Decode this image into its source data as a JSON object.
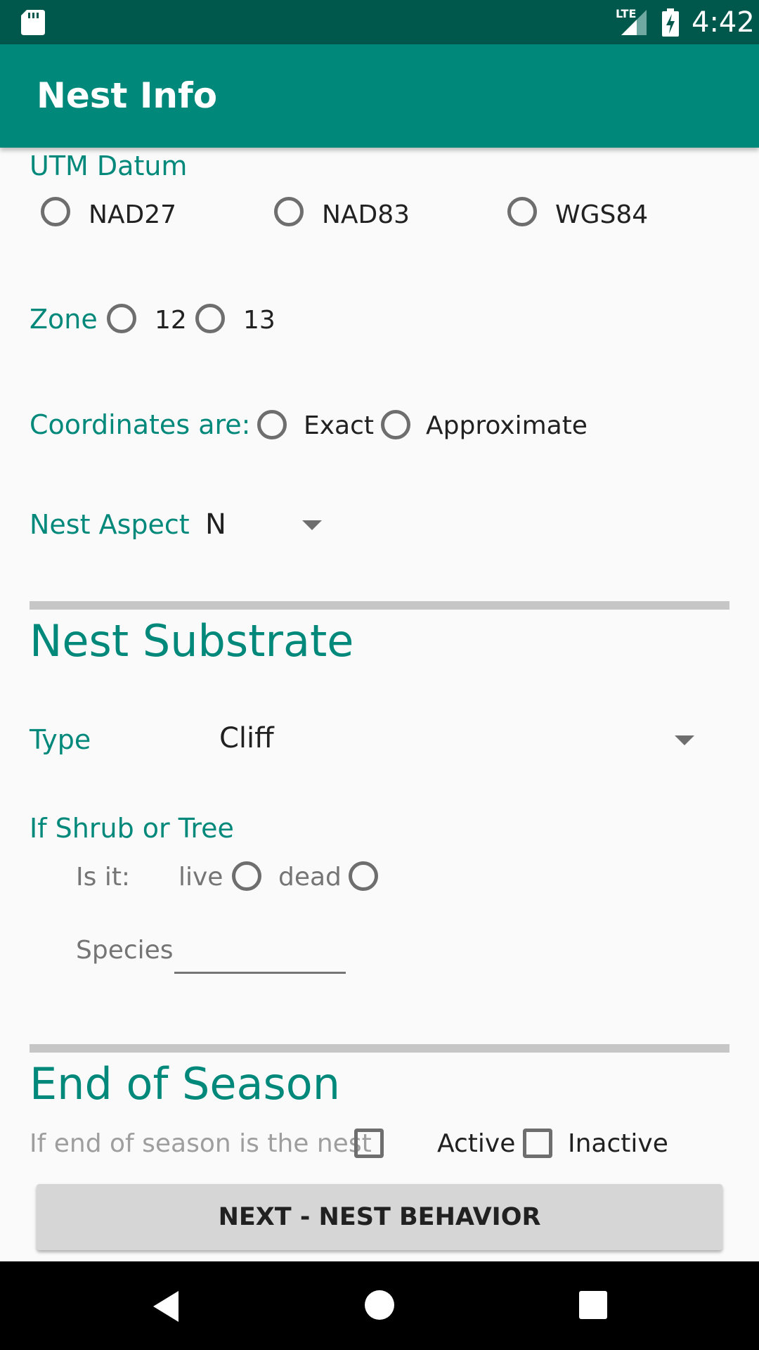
{
  "status_bar": {
    "time": "4:42",
    "network": "LTE"
  },
  "app_bar": {
    "title": "Nest Info"
  },
  "utm_datum": {
    "label": "UTM Datum",
    "options": [
      "NAD27",
      "NAD83",
      "WGS84"
    ]
  },
  "zone": {
    "label": "Zone",
    "options": [
      "12",
      "13"
    ]
  },
  "coordinates": {
    "label": "Coordinates are:",
    "options": [
      "Exact",
      "Approximate"
    ]
  },
  "nest_aspect": {
    "label": "Nest Aspect",
    "value": "N"
  },
  "nest_substrate": {
    "heading": "Nest Substrate",
    "type_label": "Type",
    "type_value": "Cliff",
    "shrub_label": "If Shrub or Tree",
    "is_it_label": "Is it:",
    "live_label": "live",
    "dead_label": "dead",
    "species_label": "Species",
    "species_value": ""
  },
  "end_of_season": {
    "heading": "End of Season",
    "prompt": "If end of season is the nest",
    "active_label": "Active",
    "inactive_label": "Inactive"
  },
  "next_button": {
    "label": "NEXT - NEST BEHAVIOR"
  },
  "colors": {
    "primary": "#00897b",
    "primary_dark": "#00574b",
    "background": "#fafafa"
  }
}
